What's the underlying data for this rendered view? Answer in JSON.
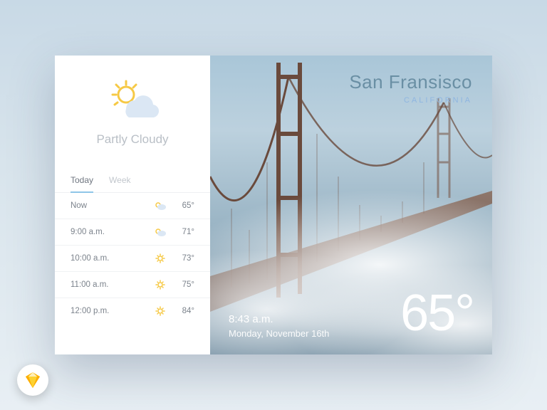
{
  "condition": {
    "label": "Partly Cloudy",
    "icon": "sun-cloud"
  },
  "tabs": {
    "active": "Today",
    "inactive": "Week"
  },
  "forecast": [
    {
      "time": "Now",
      "icon": "sun-cloud",
      "temp": "65°"
    },
    {
      "time": "9:00 a.m.",
      "icon": "sun-cloud",
      "temp": "71°"
    },
    {
      "time": "10:00 a.m.",
      "icon": "sun",
      "temp": "73°"
    },
    {
      "time": "11:00 a.m.",
      "icon": "sun",
      "temp": "75°"
    },
    {
      "time": "12:00 p.m.",
      "icon": "sun",
      "temp": "84°"
    }
  ],
  "location": {
    "city": "San Fransisco",
    "region": "CALIFORNIA"
  },
  "now": {
    "time": "8:43 a.m.",
    "date": "Monday, November 16th",
    "temp": "65°"
  },
  "badge": "sketch-icon"
}
